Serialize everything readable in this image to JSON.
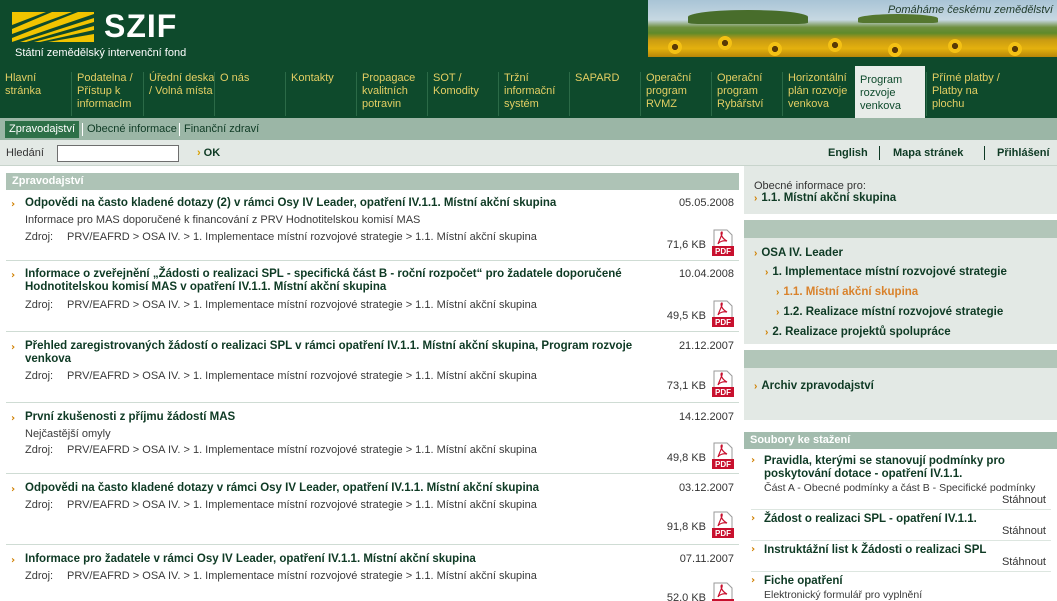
{
  "header": {
    "logo_text": "SZIF",
    "logo_subtitle": "Státní zemědělský intervenční fond",
    "tagline": "Pomáháme českému zemědělství"
  },
  "nav": [
    {
      "label": "Hlavní stránka"
    },
    {
      "label": "Podatelna / Přístup k informacím"
    },
    {
      "label": "Úřední deska / Volná místa"
    },
    {
      "label": "O nás"
    },
    {
      "label": "Kontakty"
    },
    {
      "label": "Propagace kvalitních potravin"
    },
    {
      "label": "SOT / Komodity"
    },
    {
      "label": "Tržní informační systém"
    },
    {
      "label": "SAPARD"
    },
    {
      "label": "Operační program RVMZ"
    },
    {
      "label": "Operační program Rybářství"
    },
    {
      "label": "Horizontální plán rozvoje venkova"
    },
    {
      "label": "Program rozvoje venkova",
      "active": true
    },
    {
      "label": "Přímé platby / Platby na plochu"
    }
  ],
  "subnav": [
    {
      "label": "Zpravodajství",
      "active": true
    },
    {
      "label": "Obecné informace"
    },
    {
      "label": "Finanční zdraví"
    }
  ],
  "search": {
    "label": "Hledání",
    "value": "",
    "ok_label": "OK"
  },
  "toplinks": [
    "English",
    "Mapa stránek",
    "Přihlášení"
  ],
  "news_section": {
    "title": "Zpravodajství",
    "source_label": "Zdroj:",
    "items": [
      {
        "title": "Odpovědi na často kladené dotazy (2) v rámci Osy IV Leader, opatření IV.1.1. Místní akční skupina",
        "date": "05.05.2008",
        "desc": "Informace pro MAS doporučené k financování z PRV Hodnotitelskou komisí MAS",
        "source": "PRV/EAFRD > OSA IV. > 1. Implementace místní rozvojové strategie > 1.1. Místní akční skupina",
        "size": "71,6 KB"
      },
      {
        "title": "Informace o zveřejnění „Žádosti o realizaci SPL - specifická část B - roční rozpočet“ pro žadatele doporučené Hodnotitelskou komisí MAS v opatření IV.1.1. Místní akční skupina",
        "date": "10.04.2008",
        "desc": "",
        "source": "PRV/EAFRD > OSA IV. > 1. Implementace místní rozvojové strategie > 1.1. Místní akční skupina",
        "size": "49,5 KB"
      },
      {
        "title": "Přehled zaregistrovaných žádostí o realizaci SPL v rámci opatření IV.1.1. Místní akční skupina, Program rozvoje venkova",
        "date": "21.12.2007",
        "desc": "",
        "source": "PRV/EAFRD > OSA IV. > 1. Implementace místní rozvojové strategie > 1.1. Místní akční skupina",
        "size": "73,1 KB"
      },
      {
        "title": "První zkušenosti z příjmu žádostí MAS",
        "date": "14.12.2007",
        "desc": "Nejčastější omyly",
        "source": "PRV/EAFRD > OSA IV. > 1. Implementace místní rozvojové strategie > 1.1. Místní akční skupina",
        "size": "49,8 KB"
      },
      {
        "title": "Odpovědi na často kladené dotazy v rámci Osy IV Leader, opatření IV.1.1. Místní akční skupina",
        "date": "03.12.2007",
        "desc": "",
        "source": "PRV/EAFRD > OSA IV. > 1. Implementace místní rozvojové strategie > 1.1. Místní akční skupina",
        "size": "91,8 KB"
      },
      {
        "title": "Informace pro žadatele v rámci Osy IV Leader, opatření IV.1.1. Místní akční skupina",
        "date": "07.11.2007",
        "desc": "",
        "source": "PRV/EAFRD > OSA IV. > 1. Implementace místní rozvojové strategie > 1.1. Místní akční skupina",
        "size": "52,0 KB"
      }
    ]
  },
  "sidebar": {
    "general_info_label": "Obecné informace pro:",
    "general_info_link": "1.1. Místní akční skupina",
    "tree": [
      {
        "label": "OSA IV. Leader",
        "level": 0
      },
      {
        "label": "1. Implementace místní rozvojové strategie",
        "level": 1
      },
      {
        "label": "1.1. Místní akční skupina",
        "level": 2,
        "current": true
      },
      {
        "label": "1.2. Realizace místní rozvojové strategie",
        "level": 2
      },
      {
        "label": "2. Realizace projektů spolupráce",
        "level": 1
      }
    ],
    "archive_link": "Archiv zpravodajství",
    "downloads_title": "Soubory ke stažení",
    "download_label": "Stáhnout",
    "downloads": [
      {
        "title": "Pravidla, kterými se stanovují podmínky pro poskytování dotace - opatření IV.1.1.",
        "desc": "Část A - Obecné podmínky a část B - Specifické podmínky"
      },
      {
        "title": "Žádost o realizaci SPL - opatření IV.1.1.",
        "desc": ""
      },
      {
        "title": "Instruktážní list k Žádosti o realizaci SPL",
        "desc": ""
      },
      {
        "title": "Fiche opatření",
        "desc": "Elektronický formulář pro vyplnění"
      }
    ]
  },
  "colors": {
    "brand_green": "#0e4a2c",
    "nav_text": "#e3ce63",
    "accent_orange": "#d08000",
    "logo_yellow": "#f1c400",
    "pdf_red": "#c8102e"
  }
}
